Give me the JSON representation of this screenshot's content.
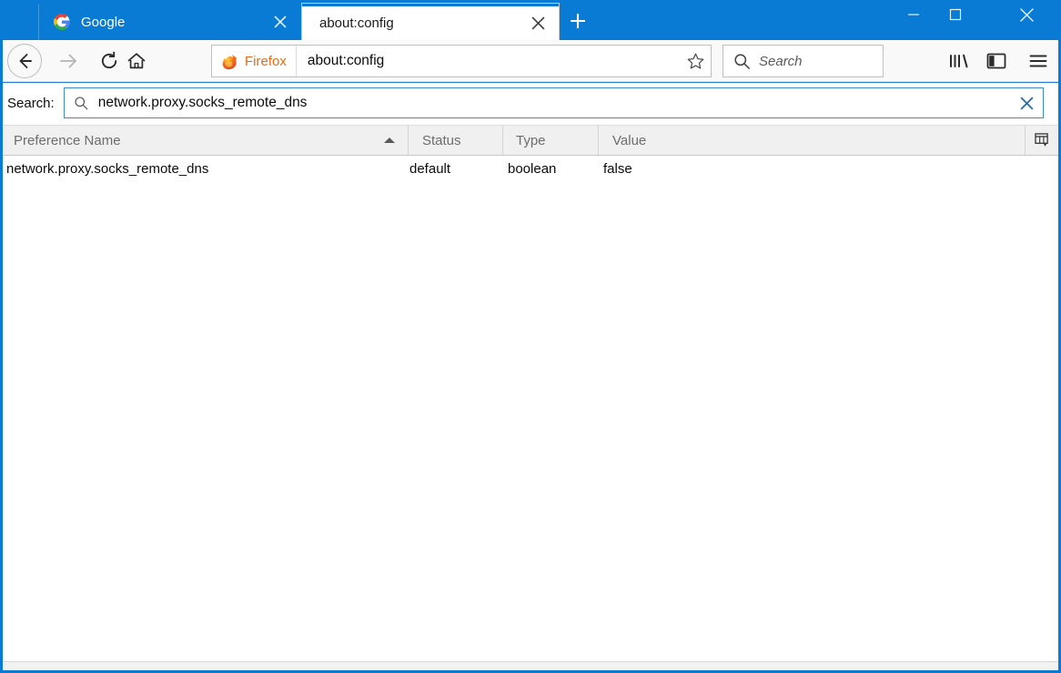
{
  "window": {
    "chrome_color": "#0a7bd4",
    "controls": {
      "minimize": "−",
      "maximize": "□",
      "close": "✕"
    }
  },
  "tabs": [
    {
      "title": "Google",
      "favicon": "google-favicon",
      "active": false,
      "close_label": "✕"
    },
    {
      "title": "about:config",
      "favicon": "none",
      "active": true,
      "close_label": "✕"
    }
  ],
  "newtab": {
    "label": "+"
  },
  "toolbar": {
    "back_label": "back-arrow",
    "forward_label": "forward-arrow",
    "reload_label": "reload-arrow",
    "home_label": "home-house",
    "identity_label": "Firefox",
    "url_value": "about:config",
    "url_placeholder": "Search or enter address",
    "bookmark_label": "star",
    "search_value": "",
    "search_placeholder": "Search",
    "library_label": "library",
    "sidebar_label": "sidebar",
    "menu_label": "menu"
  },
  "aboutconfig": {
    "search_label": "Search:",
    "search_value": "network.proxy.socks_remote_dns",
    "search_placeholder": "",
    "clear_label": "✕",
    "columns": [
      {
        "key": "name",
        "label": "Preference Name",
        "sorted": "asc"
      },
      {
        "key": "status",
        "label": "Status"
      },
      {
        "key": "type",
        "label": "Type"
      },
      {
        "key": "value",
        "label": "Value"
      }
    ],
    "rows": [
      {
        "name": "network.proxy.socks_remote_dns",
        "status": "default",
        "type": "boolean",
        "value": "false"
      }
    ]
  }
}
